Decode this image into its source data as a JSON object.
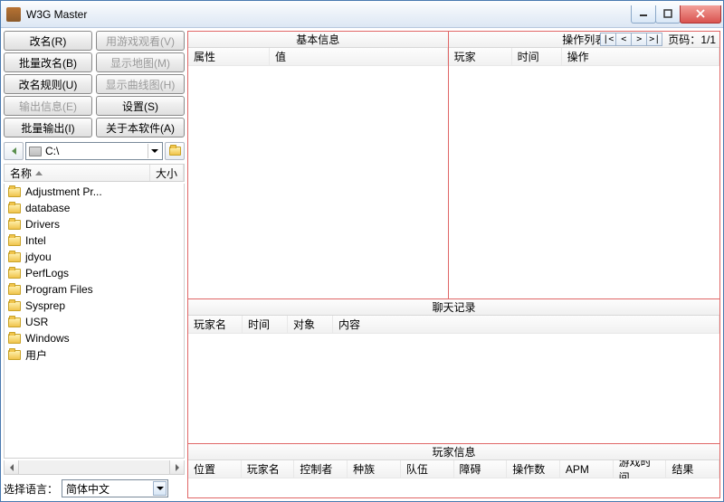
{
  "window": {
    "title": "W3G Master"
  },
  "buttons": {
    "rename": "改名(R)",
    "watch": "用游戏观看(V)",
    "batch_rename": "批量改名(B)",
    "show_map": "显示地图(M)",
    "rename_rule": "改名规则(U)",
    "show_curve": "显示曲线图(H)",
    "output_info": "输出信息(E)",
    "settings": "设置(S)",
    "batch_output": "批量输出(I)",
    "about": "关于本软件(A)"
  },
  "drive": "C:\\",
  "file_headers": {
    "name": "名称",
    "size": "大小"
  },
  "files": [
    "Adjustment Pr...",
    "database",
    "Drivers",
    "Intel",
    "jdyou",
    "PerfLogs",
    "Program Files",
    "Sysprep",
    "USR",
    "Windows",
    "用户"
  ],
  "lang": {
    "label": "选择语言：",
    "value": "简体中文"
  },
  "panels": {
    "basic": {
      "title": "基本信息",
      "cols": [
        "属性",
        "值"
      ]
    },
    "ops": {
      "title": "操作列表",
      "page_label": "页码：",
      "page_value": "1/1",
      "cols": [
        "玩家",
        "时间",
        "操作"
      ]
    },
    "chat": {
      "title": "聊天记录",
      "cols": [
        "玩家名",
        "时间",
        "对象",
        "内容"
      ]
    },
    "player": {
      "title": "玩家信息",
      "cols": [
        "位置",
        "玩家名",
        "控制者",
        "种族",
        "队伍",
        "障碍",
        "操作数",
        "APM",
        "游戏时间",
        "结果"
      ]
    }
  }
}
